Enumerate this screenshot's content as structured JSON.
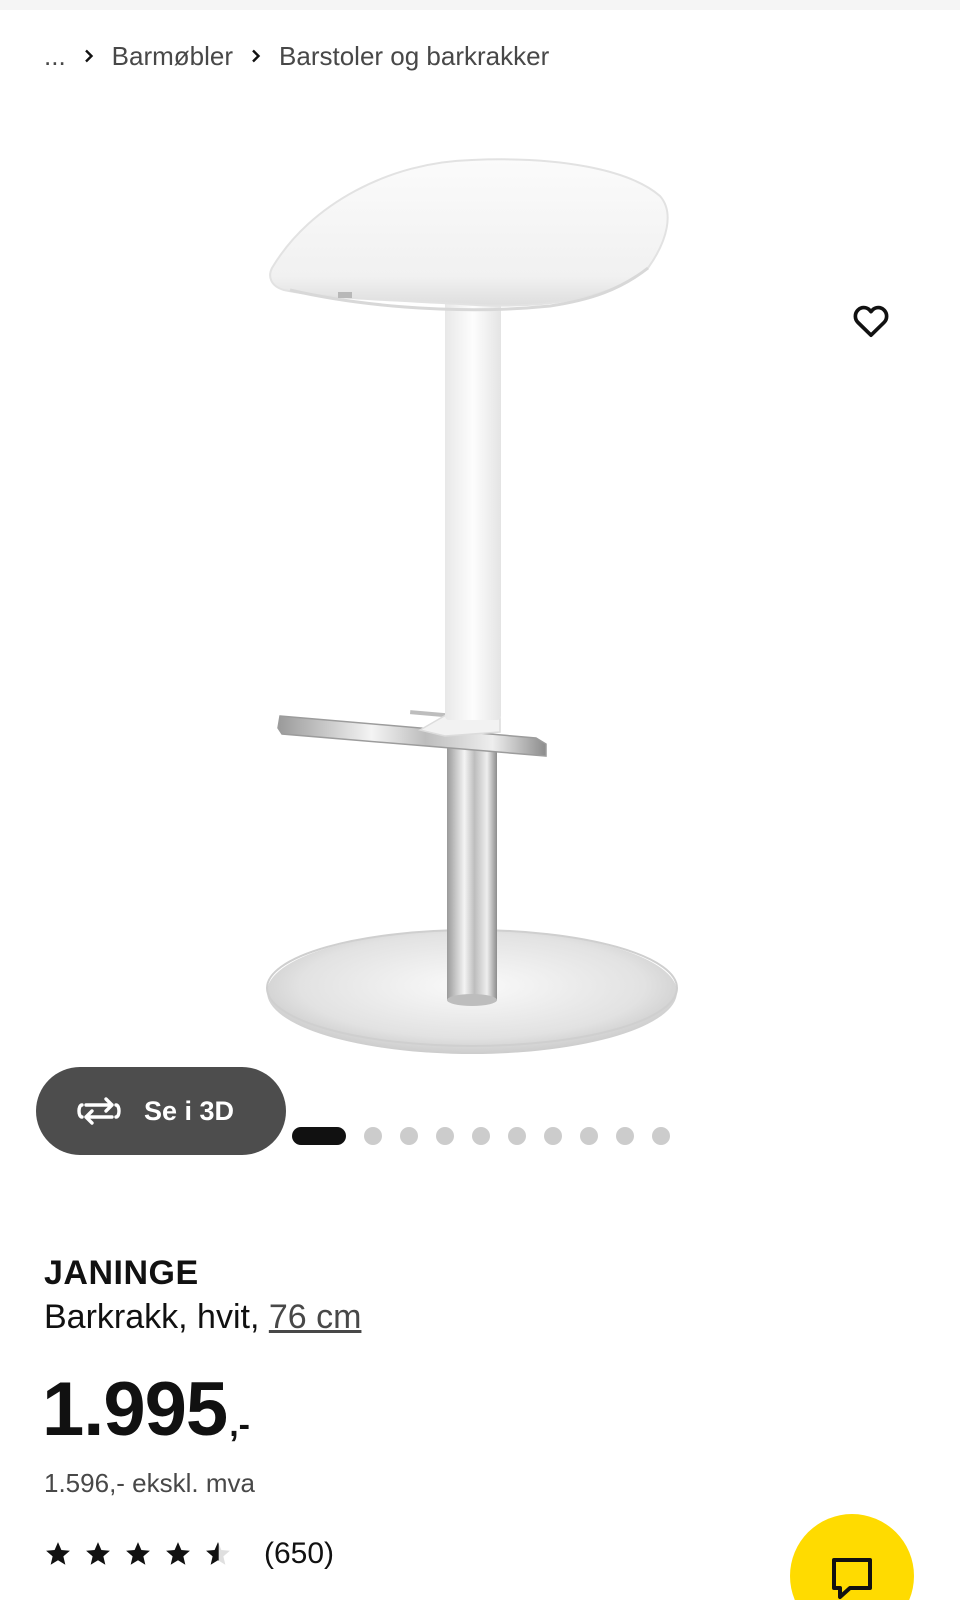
{
  "breadcrumb": {
    "items": [
      "...",
      "Barmøbler",
      "Barstoler og barkrakker"
    ]
  },
  "gallery": {
    "image_alt": "JANINGE barkrakk, hvit",
    "view_3d_label": "Se i 3D",
    "image_count": 10,
    "active_index": 0
  },
  "product": {
    "name": "JANINGE",
    "description_prefix": "Barkrakk, hvit,",
    "size_link": "76 cm"
  },
  "price": {
    "amount": "1.995",
    "suffix": ",-",
    "excl_vat": "1.596,- ekskl. mva"
  },
  "rating": {
    "score": 4.5,
    "max": 5,
    "count_label": "(650)"
  },
  "colors": {
    "accent_yellow": "#ffdb00",
    "text": "#111111",
    "secondary_text": "#484848",
    "button_dark": "#4d4d4d",
    "dot_inactive": "#cccccc"
  },
  "icons": {
    "breadcrumb_separator": "chevron-right-icon",
    "favorite": "heart-icon",
    "view_3d": "rotate-3d-icon",
    "chat": "chat-bubble-icon",
    "star": "star-icon"
  }
}
